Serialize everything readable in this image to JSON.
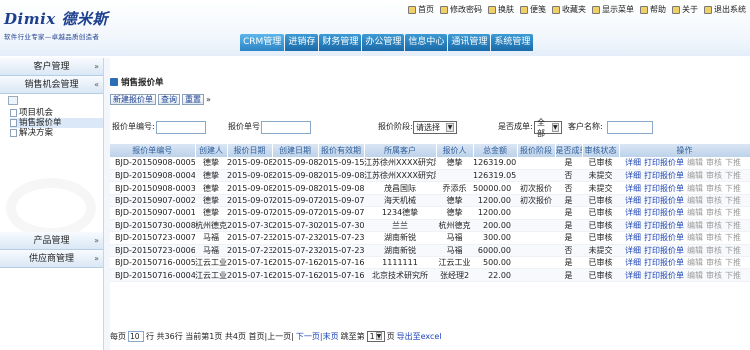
{
  "brand": {
    "title": "Dimix 德米斯",
    "subtitle": "软件行业专家—卓越品质创造者"
  },
  "topbar": [
    {
      "label": "首页",
      "icon": "home-icon"
    },
    {
      "label": "修改密码",
      "icon": "key-icon"
    },
    {
      "label": "换肤",
      "icon": "palette-icon"
    },
    {
      "label": "便笺",
      "icon": "note-icon"
    },
    {
      "label": "收藏夹",
      "icon": "star-icon"
    },
    {
      "label": "显示菜单",
      "icon": "menu-icon"
    },
    {
      "label": "帮助",
      "icon": "help-icon"
    },
    {
      "label": "关于",
      "icon": "info-icon"
    },
    {
      "label": "退出系统",
      "icon": "exit-icon"
    }
  ],
  "nav": [
    "CRM管理",
    "进销存",
    "财务管理",
    "办公管理",
    "信息中心",
    "通讯管理",
    "系统管理"
  ],
  "sidebar": {
    "sections": {
      "customer": "客户管理",
      "opportunity": "销售机会管理",
      "product": "产品管理",
      "supplier": "供应商管理"
    },
    "tree": [
      "项目机会",
      "销售报价单",
      "解决方案"
    ]
  },
  "page": {
    "title": "销售报价单"
  },
  "toolbar": {
    "add": "新建报价单",
    "query": "查询",
    "reset": "重置"
  },
  "search": {
    "no_label": "报价单编号:",
    "quote_label": "报价单号:",
    "stage_label": "报价阶段:",
    "stage_value": "请选择",
    "deal_label": "是否成单:",
    "deal_value": "全部",
    "cust_label": "客户名称:"
  },
  "table": {
    "headers": [
      "报价单编号",
      "创建人",
      "报价日期",
      "创建日期",
      "报价有效期",
      "所属客户",
      "报价人",
      "总金额",
      "报价阶段",
      "是否成单",
      "审核状态",
      "操作"
    ],
    "rows": [
      [
        "BJD-20150908-0005",
        "德挚",
        "2015-09-08",
        "2015-09-08",
        "2015-09-15",
        "江苏徐州XXXX研究院",
        "德挚",
        "126319.00",
        "",
        "是",
        "已审核"
      ],
      [
        "BJD-20150908-0004",
        "德挚",
        "2015-09-08",
        "2015-09-08",
        "2015-09-08",
        "江苏徐州XXXX研究院",
        "",
        "126319.05",
        "",
        "否",
        "未提交"
      ],
      [
        "BJD-20150908-0003",
        "德挚",
        "2015-09-08",
        "2015-09-08",
        "2015-09-08",
        "茂昌国际",
        "乔添乐",
        "50000.00",
        "初次报价",
        "否",
        "未提交"
      ],
      [
        "BJD-20150907-0002",
        "德挚",
        "2015-09-07",
        "2015-09-07",
        "2015-09-07",
        "海天机械",
        "德挚",
        "1200.00",
        "初次报价",
        "是",
        "已审核"
      ],
      [
        "BJD-20150907-0001",
        "德挚",
        "2015-09-07",
        "2015-09-07",
        "2015-09-07",
        "1234德挚",
        "德挚",
        "1200.00",
        "",
        "是",
        "已审核"
      ],
      [
        "BJD-20150730-0008",
        "杭州德克",
        "2015-07-30",
        "2015-07-30",
        "2015-07-30",
        "兰兰",
        "杭州德克",
        "200.00",
        "",
        "是",
        "已审核"
      ],
      [
        "BJD-20150723-0007",
        "马福",
        "2015-07-23",
        "2015-07-23",
        "2015-07-23",
        "湖南新锐",
        "马福",
        "300.00",
        "",
        "是",
        "已审核"
      ],
      [
        "BJD-20150723-0006",
        "马福",
        "2015-07-23",
        "2015-07-23",
        "2015-07-23",
        "湖南新锐",
        "马福",
        "6000.00",
        "",
        "否",
        "未提交"
      ],
      [
        "BJD-20150716-0005",
        "江云工业",
        "2015-07-16",
        "2015-07-16",
        "2015-07-16",
        "1111111",
        "江云工业",
        "500.00",
        "",
        "是",
        "已审核"
      ],
      [
        "BJD-20150716-0004",
        "江云工业",
        "2015-07-16",
        "2015-07-16",
        "2015-07-16",
        "北京技术研究所",
        "张经理2",
        "22.00",
        "",
        "是",
        "已审核"
      ]
    ],
    "actions": {
      "detail": "详细",
      "print": "打印报价单",
      "edit": "编辑",
      "audit": "审核",
      "order": "下推"
    }
  },
  "pager": {
    "per_page_prefix": "每页",
    "per_page": "10",
    "per_page_suffix": "行 共36行  当前第1页  共4页  首页|上一页|",
    "next_last": "下一页|末页",
    "goto_label": "跳至第",
    "goto_page": "1",
    "goto_suffix": "页",
    "export": "导出至excel"
  },
  "colors": {
    "nav": "#1a6aa8",
    "link": "#1c44b8",
    "approved": "#1a7d1a",
    "header_bg": "#bcd2ea"
  }
}
